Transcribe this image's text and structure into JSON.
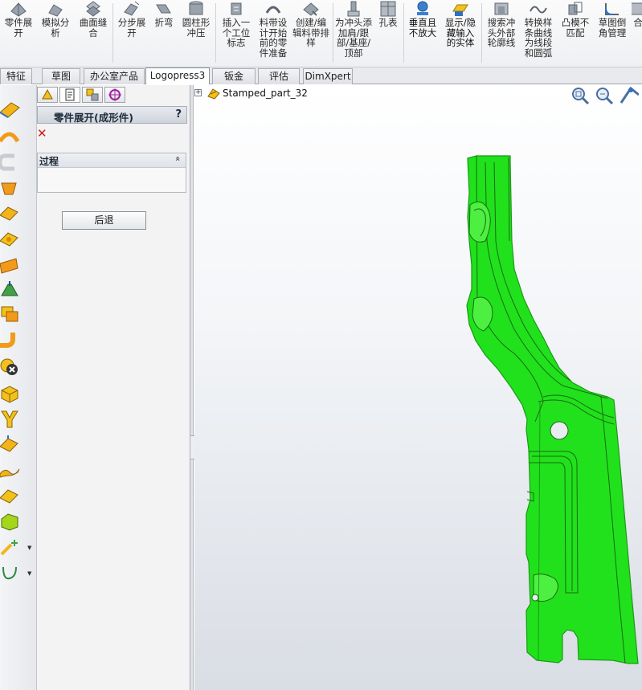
{
  "ribbon": {
    "buttons": [
      {
        "id": "unfold",
        "label": "零件展开",
        "icon": "unfold-part-icon"
      },
      {
        "id": "simulate",
        "label": "模拟分析",
        "icon": "simulation-icon"
      },
      {
        "id": "surface-knit",
        "label": "曲面缝合",
        "icon": "surface-knit-icon"
      },
      {
        "id": "step-unfold",
        "label": "分步展开",
        "icon": "step-unfold-icon"
      },
      {
        "id": "fold",
        "label": "折弯",
        "icon": "fold-icon"
      },
      {
        "id": "cyl-punch",
        "label": "圆柱形冲压",
        "icon": "cylinder-punch-icon"
      },
      {
        "id": "station-mark",
        "label": "插入一个工位标志",
        "icon": "station-mark-icon"
      },
      {
        "id": "strip-prep",
        "label": "料带设计开始前的零件准备",
        "icon": "strip-prep-icon"
      },
      {
        "id": "strip-layout",
        "label": "创建/编辑料带排样",
        "icon": "strip-layout-icon"
      },
      {
        "id": "punch-shoulder",
        "label": "为冲头添加肩/跟部/基座/顶部",
        "icon": "punch-shoulder-icon"
      },
      {
        "id": "hole-table",
        "label": "孔表",
        "icon": "hole-table-icon"
      },
      {
        "id": "normal-to",
        "label": "垂直且不放大",
        "icon": "normal-to-icon"
      },
      {
        "id": "show-hide",
        "label": "显示/隐藏输入的实体",
        "icon": "show-hide-bodies-icon"
      },
      {
        "id": "search-punch",
        "label": "搜索冲头外部轮廓线",
        "icon": "search-punch-icon"
      },
      {
        "id": "convert-spline",
        "label": "转换样条曲线为线段和圆弧",
        "icon": "convert-spline-icon"
      },
      {
        "id": "punch-mismatch",
        "label": "凸模不匹配",
        "icon": "punch-mismatch-icon"
      },
      {
        "id": "sketch-fillet",
        "label": "草图倒角管理",
        "icon": "sketch-fillet-icon"
      },
      {
        "id": "more",
        "label": "合",
        "icon": "more-icon"
      }
    ]
  },
  "tabs": [
    {
      "label": "特征",
      "active": false
    },
    {
      "label": "草图",
      "active": false
    },
    {
      "label": "办公室产品",
      "active": false
    },
    {
      "label": "Logopress3",
      "active": true
    },
    {
      "label": "钣金",
      "active": false
    },
    {
      "label": "评估",
      "active": false
    },
    {
      "label": "DimXpert",
      "active": false
    }
  ],
  "panel": {
    "title": "零件展开(成形件)",
    "help": "?",
    "close": "✕",
    "group_title": "过程",
    "group_collapse": "«",
    "back_button": "后退",
    "tabs": [
      {
        "icon": "feature-manager-icon"
      },
      {
        "icon": "property-manager-icon",
        "active": true
      },
      {
        "icon": "configuration-manager-icon"
      },
      {
        "icon": "dimxpert-manager-icon"
      }
    ]
  },
  "viewport": {
    "tree_expander": "+",
    "tree_label": "Stamped_part_32",
    "part_color": "#21e11c",
    "view_tools": [
      {
        "icon": "zoom-to-fit-icon"
      },
      {
        "icon": "zoom-to-area-icon"
      },
      {
        "icon": "view-orientation-icon"
      }
    ]
  },
  "lefttool": {
    "icons": [
      "flange-icon",
      "hem-icon",
      "u-bend-icon",
      "cone-icon",
      "flatten-surface-icon",
      "form-tool-icon",
      "plate-icon",
      "punch-up-icon",
      "copy-body-icon",
      "pipe-bend-icon",
      "delete-body-icon",
      "box-icon",
      "y-split-icon",
      "surface-offset-icon",
      "wave-surface-icon",
      "surface-patch-icon",
      "solid-box-icon",
      "sparkle-tool-icon",
      "curve-tool-icon"
    ]
  }
}
